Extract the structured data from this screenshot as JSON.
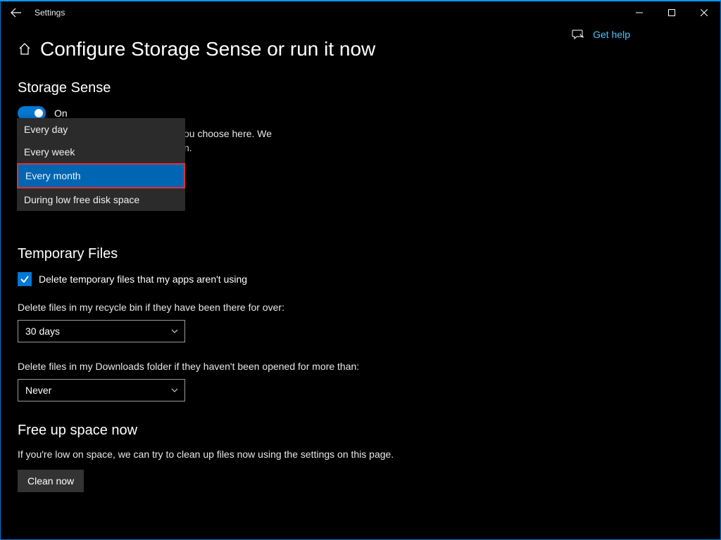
{
  "window": {
    "title": "Settings"
  },
  "page": {
    "title": "Configure Storage Sense or run it now"
  },
  "help_link": "Get help",
  "storage_sense": {
    "heading": "Storage Sense",
    "toggle_state": "On",
    "description_visible": "ou choose here. We\nn.",
    "schedule_options": [
      "Every day",
      "Every week",
      "Every month",
      "During low free disk space"
    ],
    "schedule_selected_index": 2
  },
  "temp_files": {
    "heading": "Temporary Files",
    "delete_temp_label": "Delete temporary files that my apps aren't using",
    "recycle_label": "Delete files in my recycle bin if they have been there for over:",
    "recycle_value": "30 days",
    "downloads_label": "Delete files in my Downloads folder if they haven't been opened for more than:",
    "downloads_value": "Never"
  },
  "free_up": {
    "heading": "Free up space now",
    "description": "If you're low on space, we can try to clean up files now using the settings on this page.",
    "button": "Clean now"
  }
}
